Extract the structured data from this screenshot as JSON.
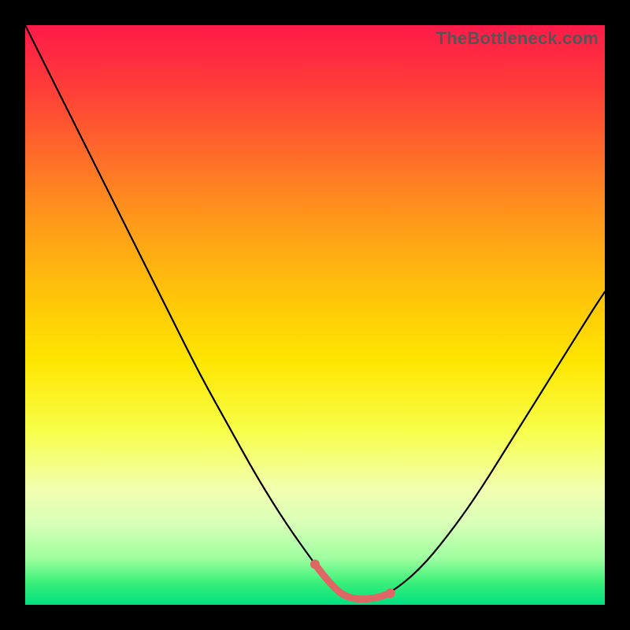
{
  "watermark": "TheBottleneck.com",
  "chart_data": {
    "type": "line",
    "title": "",
    "xlabel": "",
    "ylabel": "",
    "xlim": [
      0,
      1
    ],
    "ylim": [
      0,
      1
    ],
    "series": [
      {
        "name": "main-curve",
        "color": "#000000",
        "x": [
          0.0,
          0.05,
          0.1,
          0.15,
          0.2,
          0.25,
          0.3,
          0.35,
          0.4,
          0.45,
          0.5,
          0.53,
          0.56,
          0.6,
          0.63,
          0.68,
          0.73,
          0.78,
          0.83,
          0.88,
          0.93,
          0.98,
          1.0
        ],
        "y": [
          1.0,
          0.9,
          0.8,
          0.7,
          0.6,
          0.5,
          0.4,
          0.31,
          0.22,
          0.14,
          0.07,
          0.03,
          0.01,
          0.01,
          0.02,
          0.06,
          0.12,
          0.19,
          0.27,
          0.35,
          0.43,
          0.51,
          0.54
        ]
      },
      {
        "name": "highlight-segment",
        "color": "#e06666",
        "x": [
          0.5,
          0.53,
          0.56,
          0.6,
          0.63
        ],
        "y": [
          0.07,
          0.03,
          0.01,
          0.01,
          0.02
        ]
      }
    ]
  }
}
